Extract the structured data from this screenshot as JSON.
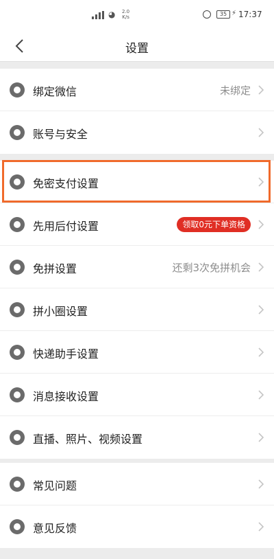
{
  "status_bar": {
    "network_speed": "2.0",
    "network_unit": "K/s",
    "battery": "35",
    "time": "17:37"
  },
  "nav": {
    "title": "设置"
  },
  "account_group": [
    {
      "label": "绑定微信",
      "value": "未绑定",
      "icon": "wechat-icon"
    },
    {
      "label": "账号与安全",
      "value": "",
      "icon": "shield-icon"
    }
  ],
  "settings_group": [
    {
      "label": "免密支付设置",
      "value": "",
      "icon": "key-icon",
      "highlighted": true
    },
    {
      "label": "先用后付设置",
      "badge": "领取0元下单资格",
      "icon": "clock-icon"
    },
    {
      "label": "免拼设置",
      "value": "还剩3次免拼机会",
      "icon": "group-icon"
    },
    {
      "label": "拼小圈设置",
      "value": "",
      "icon": "bag-icon"
    },
    {
      "label": "快递助手设置",
      "value": "",
      "icon": "package-icon"
    },
    {
      "label": "消息接收设置",
      "value": "",
      "icon": "message-icon"
    },
    {
      "label": "直播、照片、视频设置",
      "value": "",
      "icon": "media-icon"
    }
  ],
  "help_group": [
    {
      "label": "常见问题",
      "value": "",
      "icon": "question-icon"
    },
    {
      "label": "意见反馈",
      "value": "",
      "icon": "feedback-icon"
    }
  ],
  "colors": {
    "highlight_border": "#f06a2b",
    "badge_bg": "#e02e24",
    "secondary_text": "#8d8d8d"
  }
}
